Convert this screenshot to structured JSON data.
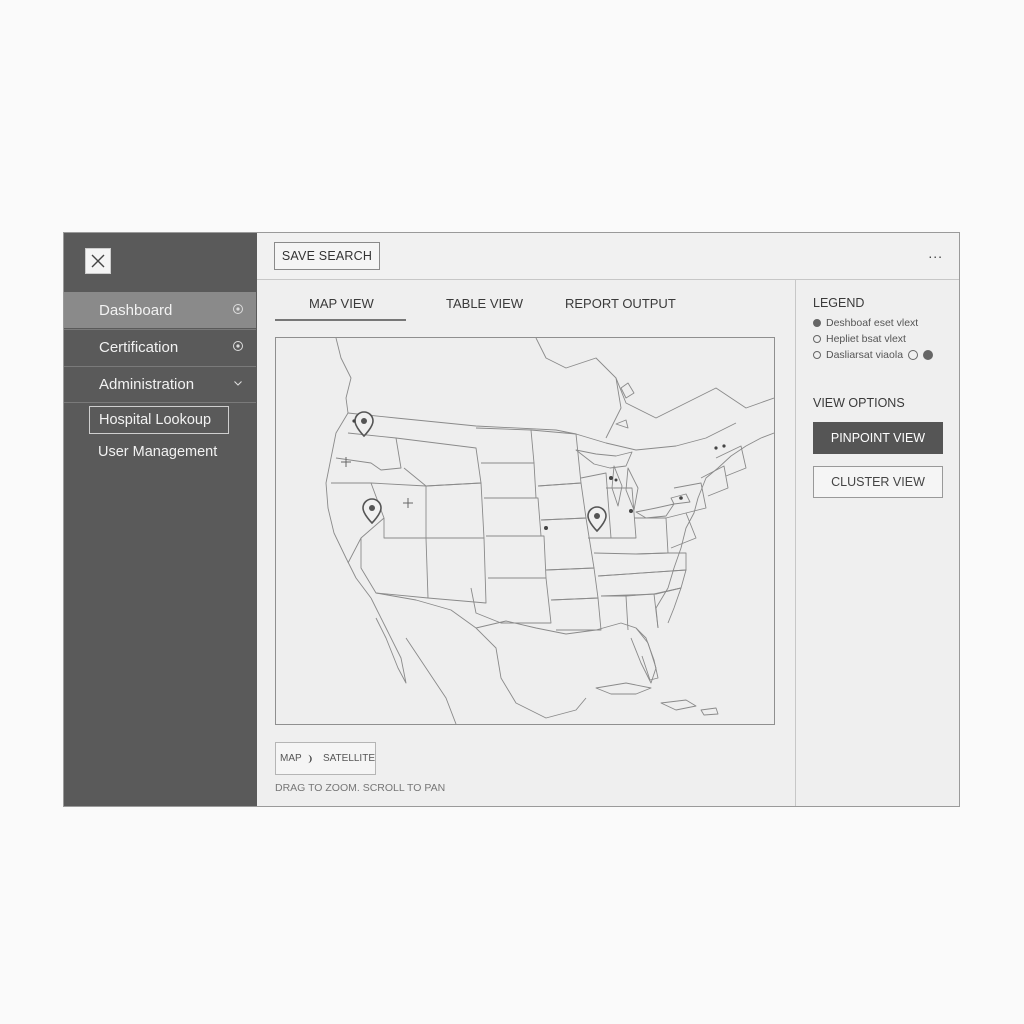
{
  "sidebar": {
    "items": [
      {
        "label": "Dashboard"
      },
      {
        "label": "Certification"
      },
      {
        "label": "Administration"
      }
    ],
    "sub_items": [
      {
        "label": "Hospital Lookoup"
      },
      {
        "label": "User Management"
      }
    ]
  },
  "toolbar": {
    "save_label": "SAVE SEARCH",
    "more_label": "..."
  },
  "tabs": [
    {
      "label": "MAP VIEW",
      "active": true
    },
    {
      "label": "TABLE VIEW"
    },
    {
      "label": "REPORT OUTPUT"
    }
  ],
  "map": {
    "toggle_map_label": "MAP",
    "toggle_satellite_label": "SATELLITE",
    "hint": "DRAG TO ZOOM. SCROLL TO PAN"
  },
  "legend": {
    "title": "LEGEND",
    "items": [
      {
        "label": "Deshboaf eset vlext"
      },
      {
        "label": "Hepliet bsat vlext"
      },
      {
        "label": "Dasliarsat viaola"
      }
    ]
  },
  "view_options": {
    "title": "VIEW OPTIONS",
    "pinpoint_label": "PINPOINT VIEW",
    "cluster_label": "CLUSTER VIEW"
  },
  "colors": {
    "sidebar_bg": "#5a5a5a",
    "active_nav": "#8a8a8a",
    "primary_button": "#555555"
  }
}
